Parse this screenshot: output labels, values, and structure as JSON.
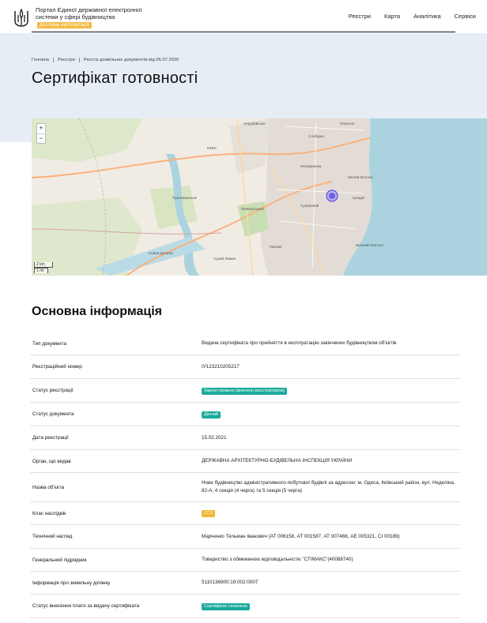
{
  "header": {
    "brand": "Портал Єдиної державної електронної системи у сфері будівництва",
    "brand_badge": "Дослідна експлуатація",
    "nav": [
      "Реєстри",
      "Карта",
      "Аналітика",
      "Сервіси"
    ]
  },
  "breadcrumbs": [
    "Головна",
    "Реєстри",
    "Реєстр дозвільних документів від 06.07.2020"
  ],
  "page_title": "Сертифікат готовності",
  "map": {
    "zoom_in": "+",
    "zoom_out": "−",
    "scale_km": "2 km",
    "scale_mi": "1 mi",
    "labels": [
      "Лиманка",
      "Чорноморка",
      "Аркадія",
      "Великий Фонтан",
      "Малий Фонтан",
      "Таїрове",
      "Приморський",
      "Суворовий",
      "Пересип",
      "Слобідка",
      "Молдаванка",
      "Сухий Лиман",
      "Новая Долина",
      "Прилиманське",
      "Усатове",
      "Нерубайське",
      "КЕБС",
      "Червоний Хутір",
      "Мирне",
      "Лузанівка"
    ]
  },
  "section_title": "Основна інформація",
  "info": [
    {
      "label": "Тип документа",
      "value": "Видача сертифіката про прийняття в експлуатацію закінчених будівництвом об'єктів"
    },
    {
      "label": "Реєстраційний номер",
      "value": "ІУ123210205217"
    },
    {
      "label": "Статус реєстрації",
      "badge": "Зареєстровано (внесено реєстратором)",
      "badge_color": "#1aa99c"
    },
    {
      "label": "Статус документа",
      "badge": "Діючий",
      "badge_color": "#1aa99c"
    },
    {
      "label": "Дата реєстрації",
      "value": "15.02.2021"
    },
    {
      "label": "Орган, що видав",
      "value": "ДЕРЖАВНА АРХІТЕКТУРНО-БУДІВЕЛЬНА ІНСПЕКЦІЯ УКРАЇНИ"
    },
    {
      "label": "Назва об'єкта",
      "value": "Нове будівництво адміністративного-побутової будівлі за адресою: м. Одеса, Київський район, вул. Неделіна, 82-А, 4 секція (4 черга) та 5 секція (5 черга)"
    },
    {
      "label": "Клас наслідків",
      "badge": "СС2",
      "badge_color": "#f2b632"
    },
    {
      "label": "Технічний нагляд",
      "value": "Марченко Тельман Іванович (АТ 006158, АТ 001587, АТ 007466, АЕ 005321, СІ 00189)"
    },
    {
      "label": "Генеральний підрядник",
      "value": "Товариство з обмеженою відповідальністю \"СТІМАКС\"(40088740)"
    },
    {
      "label": "Інформація про земельну ділянку",
      "value": "5110136900:19:002:0007"
    },
    {
      "label": "Статус внесення плати за видачу сертифіката",
      "badge": "Сертифікат сплачено",
      "badge_color": "#1aa99c"
    }
  ]
}
